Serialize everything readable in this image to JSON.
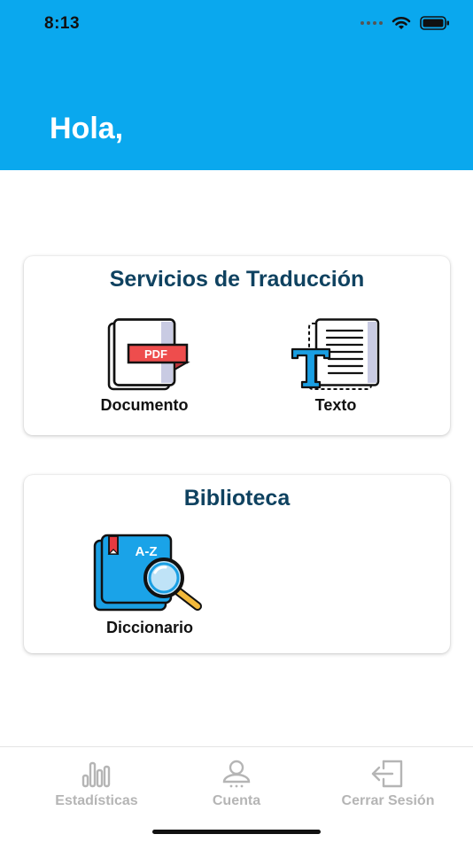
{
  "status_bar": {
    "time": "8:13",
    "icons": [
      "cellular-dots-icon",
      "wifi-icon",
      "battery-icon"
    ]
  },
  "header": {
    "greeting": "Hola,",
    "background_color": "#0aa8ee"
  },
  "services_card": {
    "title": "Servicios de Traducción",
    "items": [
      {
        "label": "Documento",
        "icon": "pdf-document-icon",
        "badge_text": "PDF"
      },
      {
        "label": "Texto",
        "icon": "text-document-icon"
      }
    ]
  },
  "library_card": {
    "title": "Biblioteca",
    "items": [
      {
        "label": "Diccionario",
        "icon": "dictionary-book-icon",
        "badge_text": "A-Z"
      }
    ]
  },
  "tab_bar": {
    "items": [
      {
        "label": "Estadísticas",
        "icon": "bar-chart-icon"
      },
      {
        "label": "Cuenta",
        "icon": "user-icon"
      },
      {
        "label": "Cerrar Sesión",
        "icon": "logout-icon"
      }
    ],
    "inactive_color": "#b5b5b5"
  },
  "colors": {
    "title_color": "#0f4260",
    "pdf_red": "#ee4d4d",
    "accent_blue": "#1a9fe3"
  }
}
